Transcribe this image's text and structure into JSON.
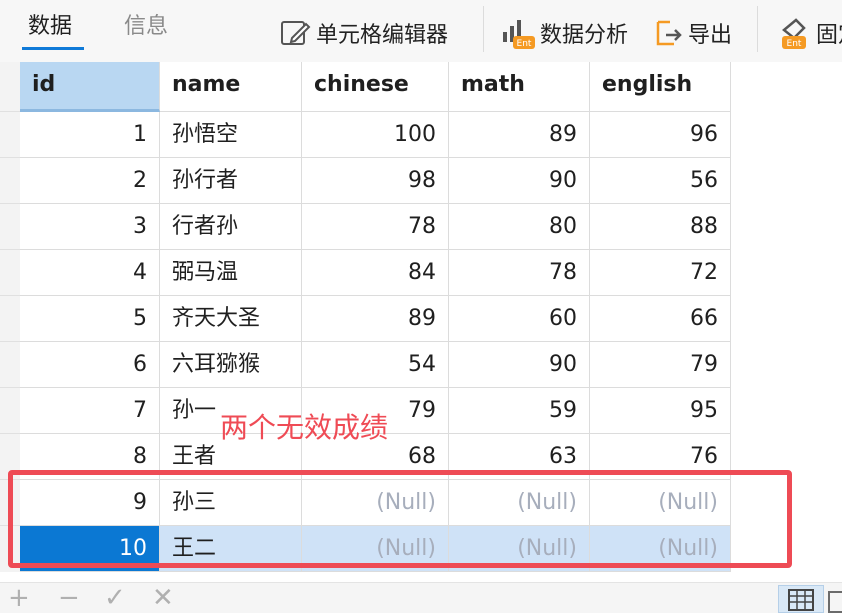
{
  "tabs": [
    {
      "label": "数据",
      "active": true
    },
    {
      "label": "信息",
      "active": false
    }
  ],
  "toolbar": {
    "cell_editor": "单元格编辑器",
    "data_analysis": "数据分析",
    "export": "导出",
    "pin": "固定",
    "ent_badge": "Ent"
  },
  "columns": [
    "id",
    "name",
    "chinese",
    "math",
    "english"
  ],
  "rows": [
    [
      "1",
      "孙悟空",
      "100",
      "89",
      "96"
    ],
    [
      "2",
      "孙行者",
      "98",
      "90",
      "56"
    ],
    [
      "3",
      "行者孙",
      "78",
      "80",
      "88"
    ],
    [
      "4",
      "弼马温",
      "84",
      "78",
      "72"
    ],
    [
      "5",
      "齐天大圣",
      "89",
      "60",
      "66"
    ],
    [
      "6",
      "六耳猕猴",
      "54",
      "90",
      "79"
    ],
    [
      "7",
      "孙一",
      "79",
      "59",
      "95"
    ],
    [
      "8",
      "王者",
      "68",
      "63",
      "76"
    ],
    [
      "9",
      "孙三",
      "(Null)",
      "(Null)",
      "(Null)"
    ],
    [
      "10",
      "王二",
      "(Null)",
      "(Null)",
      "(Null)"
    ]
  ],
  "selected_row_index": 9,
  "annotation": {
    "text": "两个无效成绩",
    "color": "#ee4b55"
  },
  "colors": {
    "accent": "#0b78d3",
    "selected_row": "#cfe2f7",
    "null_text": "#a7aebc"
  },
  "bottom_bar": {
    "icons": [
      "add-icon",
      "remove-icon",
      "confirm-icon",
      "cancel-icon",
      "grid-view-icon",
      "form-view-icon"
    ]
  }
}
